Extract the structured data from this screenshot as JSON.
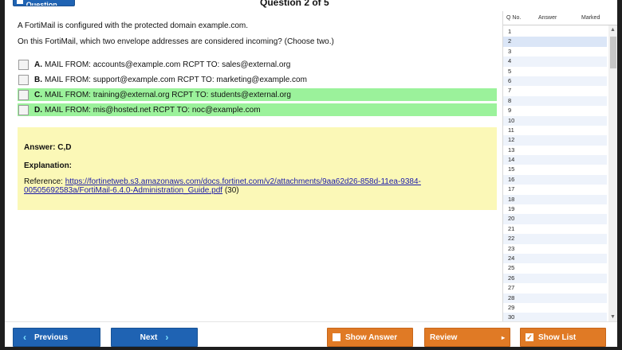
{
  "header": {
    "mark_label": "Mark Question",
    "counter": "Question 2 of 5"
  },
  "question": {
    "line1": "A FortiMail is configured with the protected domain example.com.",
    "line2": "On this FortiMail, which two envelope addresses are considered incoming? (Choose two.)",
    "options": [
      {
        "letter": "A.",
        "text": "MAIL FROM: accounts@example.com RCPT TO: sales@external.org",
        "correct": false
      },
      {
        "letter": "B.",
        "text": "MAIL FROM: support@example.com RCPT TO: marketing@example.com",
        "correct": false
      },
      {
        "letter": "C.",
        "text": "MAIL FROM: training@external.org RCPT TO: students@external.org",
        "correct": true
      },
      {
        "letter": "D.",
        "text": "MAIL FROM: mis@hosted.net RCPT TO: noc@example.com",
        "correct": true
      }
    ]
  },
  "answer": {
    "answer_text": "Answer: C,D",
    "explanation_label": "Explanation:",
    "reference_prefix": "Reference: ",
    "reference_link": "https://fortinetweb.s3.amazonaws.com/docs.fortinet.com/v2/attachments/9aa62d26-858d-11ea-9384-00505692583a/FortiMail-6.4.0-Administration_Guide.pdf",
    "reference_suffix": " (30)"
  },
  "question_list": {
    "col_no": "Q No.",
    "col_answer": "Answer",
    "col_marked": "Marked",
    "rows": [
      "1",
      "2",
      "3",
      "4",
      "5",
      "6",
      "7",
      "8",
      "9",
      "10",
      "11",
      "12",
      "13",
      "14",
      "15",
      "16",
      "17",
      "18",
      "19",
      "20",
      "21",
      "22",
      "23",
      "24",
      "25",
      "26",
      "27",
      "28",
      "29",
      "30"
    ],
    "selected_row": "2"
  },
  "footer": {
    "previous": "Previous",
    "next": "Next",
    "show_answer": "Show Answer",
    "review": "Review",
    "show_list": "Show List"
  },
  "colors": {
    "primary_blue": "#1f63b3",
    "action_orange": "#e07a25",
    "correct_green": "#9bf29b",
    "answer_yellow": "#fbf8b7"
  },
  "icons": {
    "prev": "chevron-left-icon",
    "next": "chevron-right-icon",
    "show_answer": "checkbox-icon",
    "show_list": "checkbox-checked-icon"
  }
}
